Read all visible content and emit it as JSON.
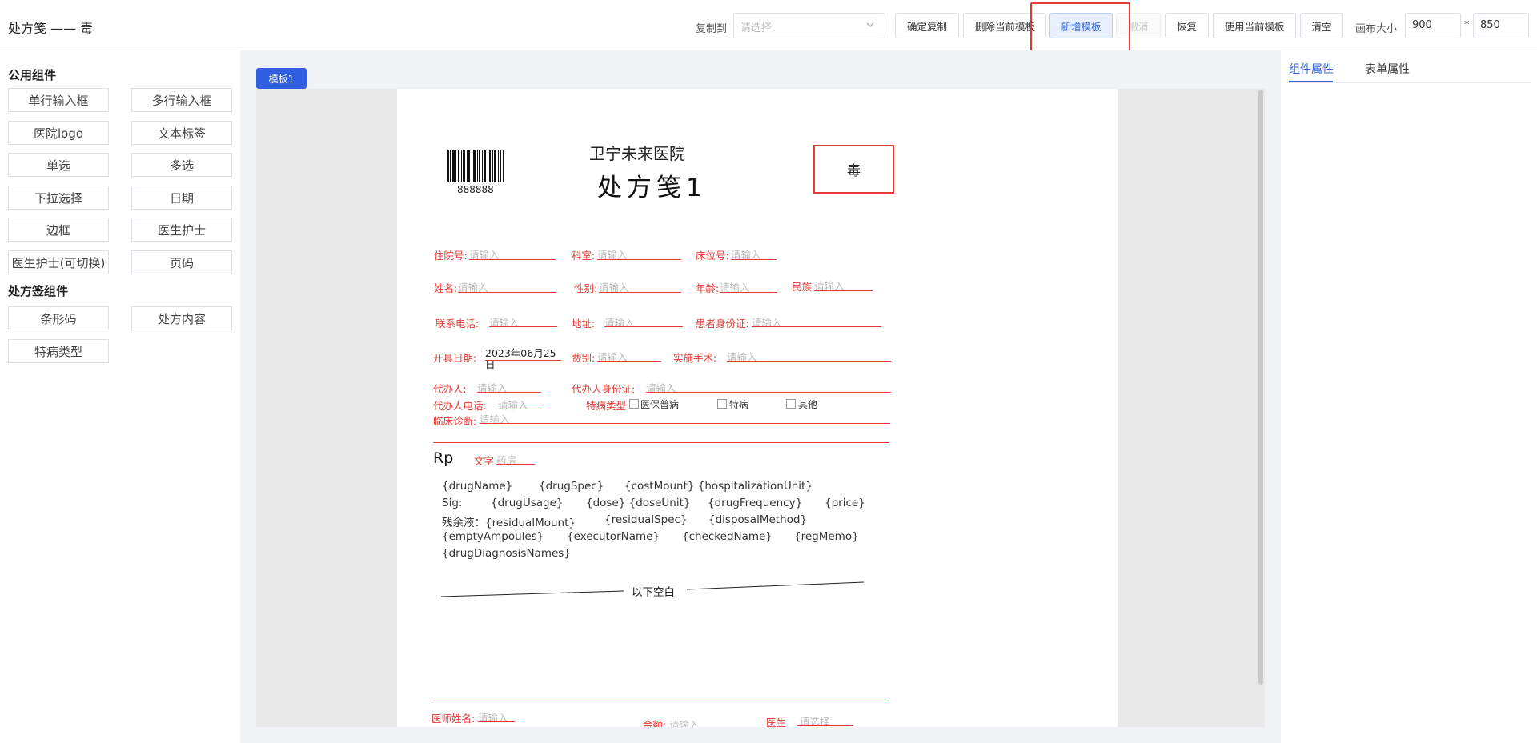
{
  "header": {
    "title": "处方笺 —— 毒",
    "copy_to_label": "复制到",
    "copy_to_placeholder": "请选择",
    "buttons": {
      "confirm_copy": "确定复制",
      "delete_template": "删除当前模板",
      "add_template": "新增模板",
      "cancel": "撤消",
      "restore": "恢复",
      "use_template": "使用当前模板",
      "clear": "清空"
    },
    "canvas_size_label": "画布大小",
    "canvas_width": "900",
    "canvas_times": "*",
    "canvas_height": "850",
    "annotation_color": "#e53935"
  },
  "left_panel": {
    "common_title": "公用组件",
    "common_items": [
      "单行输入框",
      "多行输入框",
      "医院logo",
      "文本标签",
      "单选",
      "多选",
      "下拉选择",
      "日期",
      "边框",
      "医生护士",
      "医生护士(可切换)",
      "页码"
    ],
    "rx_title": "处方签组件",
    "rx_items": [
      "条形码",
      "处方内容",
      "特病类型"
    ]
  },
  "template_tab": "模板1",
  "paper": {
    "barcode_number": "888888",
    "hospital_name": "卫宁未来医院",
    "rx_title": "处方笺1",
    "poison_label": "毒",
    "placeholder": "请输入",
    "select_placeholder": "请选择",
    "fields": {
      "inpatient_no": "住院号:",
      "department": "科室:",
      "bed_no": "床位号:",
      "name": "姓名:",
      "gender": "性别:",
      "age": "年龄:",
      "ethnicity": "民族",
      "phone": "联系电话:",
      "address": "地址:",
      "patient_id": "患者身份证:",
      "issue_date": "开具日期:",
      "issue_date_value": "2023年06月25日",
      "fee_type": "费别:",
      "surgery": "实施手术:",
      "agent": "代办人:",
      "agent_id": "代办人身份证:",
      "agent_phone": "代办人电话:",
      "special_type": "特病类型",
      "diagnosis": "临床诊断:",
      "doctor_name": "医师姓名:",
      "amount": "金额:",
      "doctor": "医生"
    },
    "special_options": [
      "医保普病",
      "特病",
      "其他"
    ],
    "rp_label": "Rp",
    "text_label": "文字",
    "pharmacy": "药房",
    "drug_lines": [
      [
        "{drugName}",
        "{drugSpec}",
        "{costMount} {hospitalizationUnit}"
      ],
      [
        "Sig:",
        "{drugUsage}",
        "{dose} {doseUnit}",
        "{drugFrequency}",
        "{price}"
      ],
      [
        "残余液：{residualMount}",
        "{residualSpec}",
        "{disposalMethod}"
      ],
      [
        "{emptyAmpoules}",
        "{executorName}",
        "{checkedName}",
        "{regMemo}"
      ],
      [
        "{drugDiagnosisNames}"
      ]
    ],
    "blank_below": "以下空白"
  },
  "right_panel": {
    "tab_component": "组件属性",
    "tab_form": "表单属性"
  }
}
